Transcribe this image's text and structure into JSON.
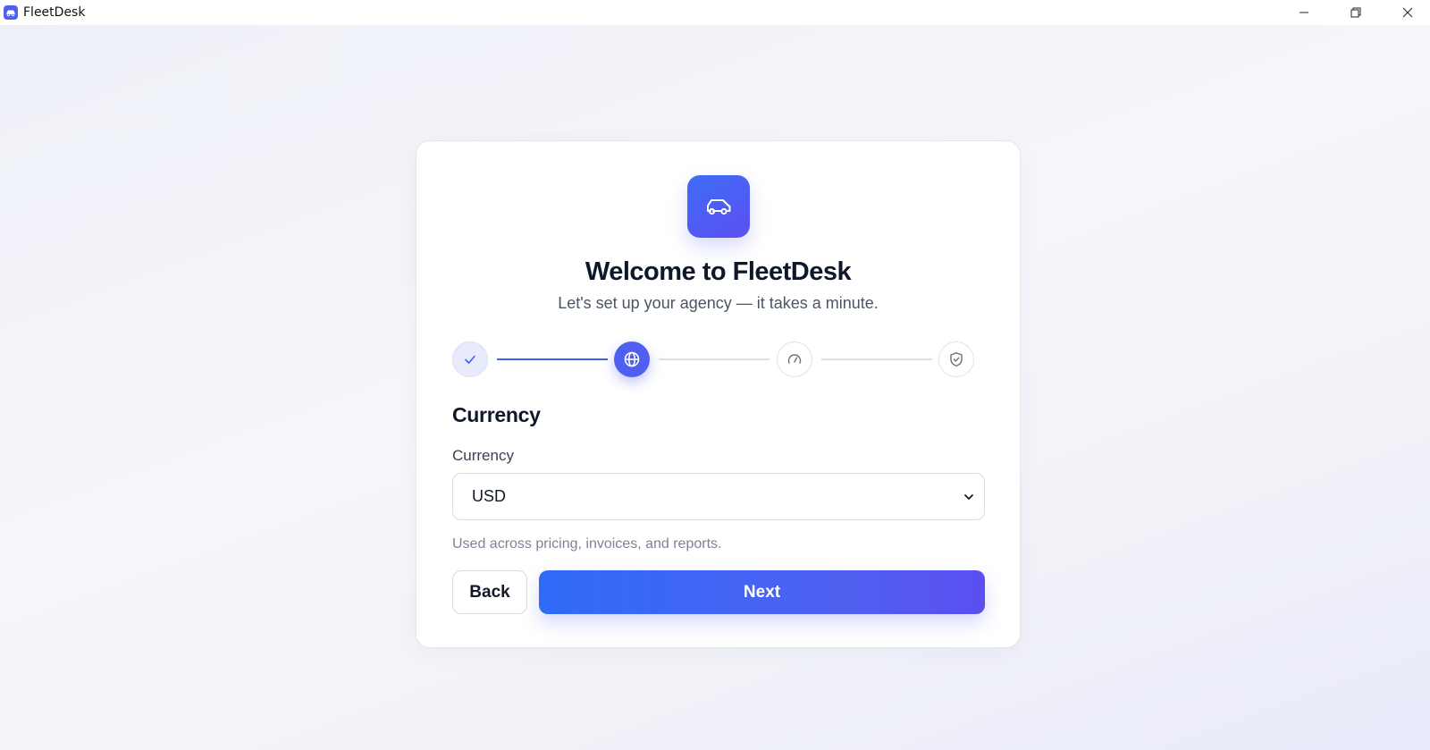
{
  "window": {
    "title": "FleetDesk",
    "app_icon": "car-icon",
    "controls": [
      "minimize-icon",
      "restore-icon",
      "close-icon"
    ]
  },
  "card": {
    "logo_icon": "car-icon",
    "headline": "Welcome to FleetDesk",
    "subline": "Let's set up your agency — it takes a minute."
  },
  "stepper": {
    "steps": [
      {
        "icon": "check-icon",
        "state": "done"
      },
      {
        "icon": "globe-icon",
        "state": "active"
      },
      {
        "icon": "gauge-icon",
        "state": "pending"
      },
      {
        "icon": "shield-check-icon",
        "state": "pending"
      }
    ]
  },
  "form": {
    "section_title": "Currency",
    "currency_label": "Currency",
    "currency_value": "USD",
    "helper_text": "Used across pricing, invoices, and reports."
  },
  "actions": {
    "back_label": "Back",
    "next_label": "Next"
  },
  "colors": {
    "accent": "#4f5ff0",
    "accent_blue": "#2f6bf7",
    "heading": "#0f172a",
    "muted": "#7b8494"
  }
}
